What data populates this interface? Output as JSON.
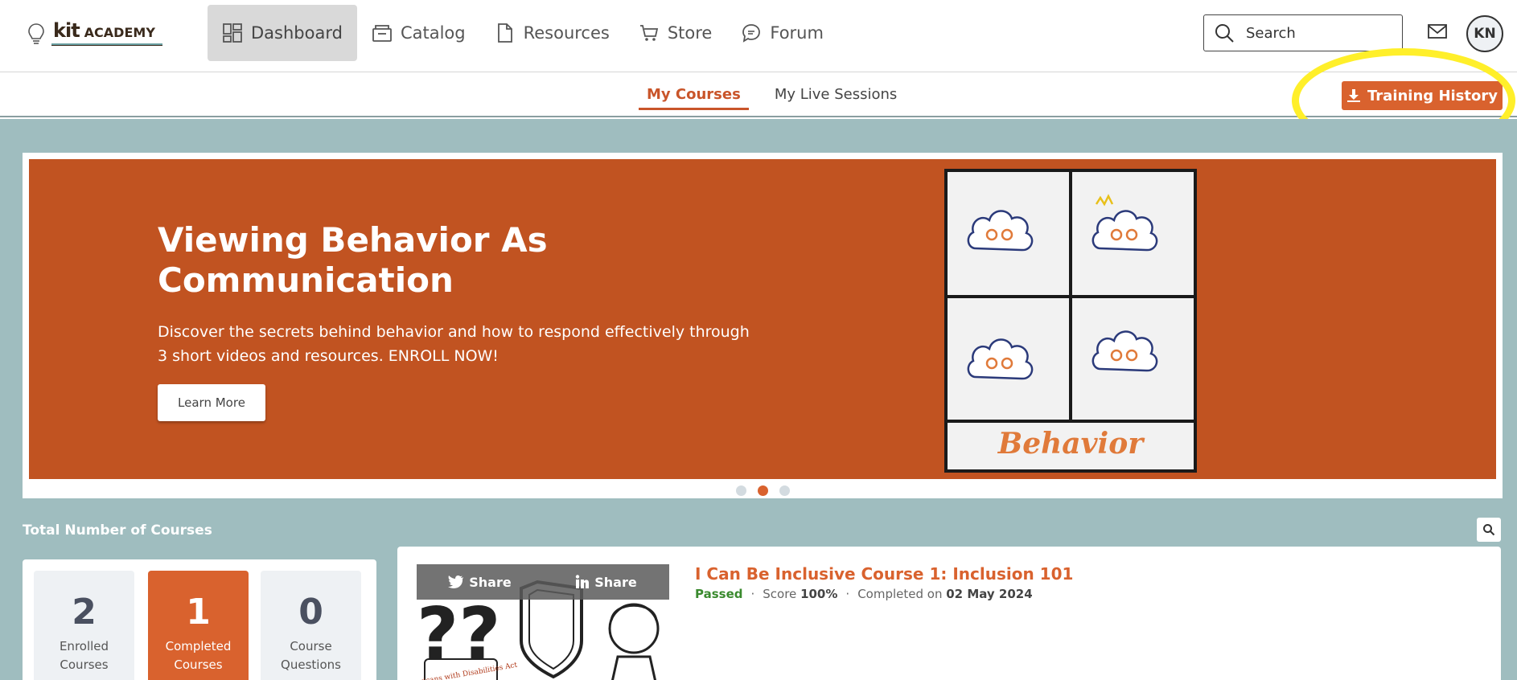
{
  "header": {
    "logo_text_kit": "kit",
    "logo_text_academy": "ACADEMY",
    "nav": [
      {
        "label": "Dashboard",
        "icon": "dashboard-icon",
        "active": true
      },
      {
        "label": "Catalog",
        "icon": "catalog-icon"
      },
      {
        "label": "Resources",
        "icon": "document-icon"
      },
      {
        "label": "Store",
        "icon": "cart-icon"
      },
      {
        "label": "Forum",
        "icon": "chat-icon"
      }
    ],
    "search_placeholder": "Search",
    "avatar_initials": "KN"
  },
  "subnav": {
    "tabs": [
      {
        "label": "My Courses",
        "active": true
      },
      {
        "label": "My Live Sessions"
      }
    ],
    "training_history_label": "Training History"
  },
  "banner": {
    "title": "Viewing Behavior As Communication",
    "description": "Discover the secrets behind behavior and how to respond effectively through 3 short videos and resources. ENROLL NOW!",
    "button_label": "Learn More",
    "image_caption": "Behavior",
    "active_slide": 2,
    "slide_count": 3
  },
  "stats": {
    "section_label": "Total Number of Courses",
    "items": [
      {
        "value": "2",
        "label_line1": "Enrolled",
        "label_line2": "Courses"
      },
      {
        "value": "1",
        "label_line1": "Completed",
        "label_line2": "Courses",
        "active": true
      },
      {
        "value": "0",
        "label_line1": "Course",
        "label_line2": "Questions"
      }
    ]
  },
  "course": {
    "title": "I Can Be Inclusive Course 1: Inclusion 101",
    "status": "Passed",
    "score_label": "Score",
    "score_value": "100%",
    "completed_label": "Completed on",
    "completed_date": "02 May 2024",
    "share_twitter": "Share",
    "share_linkedin": "Share",
    "thumb_scroll_text": "Americans with Disabilities Act"
  },
  "colors": {
    "accent": "#d9622e",
    "banner_bg": "#c15321",
    "page_bg": "#9fbdbf",
    "passed": "#3a8a2e",
    "annotation": "#ffef2a"
  }
}
